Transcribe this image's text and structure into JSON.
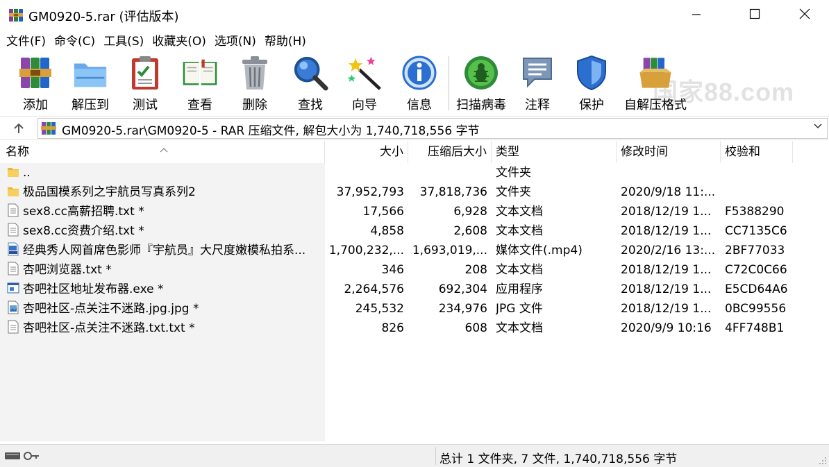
{
  "window": {
    "title": "GM0920-5.rar (评估版本)",
    "minimize_glyph": "—",
    "maximize_glyph": "☐",
    "close_glyph": "✕"
  },
  "menu": [
    "文件(F)",
    "命令(C)",
    "工具(S)",
    "收藏夹(O)",
    "选项(N)",
    "帮助(H)"
  ],
  "toolbar": [
    {
      "label": "添加",
      "icon": "add-archive-icon"
    },
    {
      "label": "解压到",
      "icon": "extract-folder-icon"
    },
    {
      "label": "测试",
      "icon": "test-clipboard-icon"
    },
    {
      "label": "查看",
      "icon": "view-book-icon"
    },
    {
      "label": "删除",
      "icon": "trash-icon"
    },
    {
      "label": "查找",
      "icon": "magnifier-icon"
    },
    {
      "label": "向导",
      "icon": "wizard-wand-icon"
    },
    {
      "label": "信息",
      "icon": "info-icon"
    },
    {
      "label": "扫描病毒",
      "icon": "virus-scan-icon"
    },
    {
      "label": "注释",
      "icon": "comment-icon"
    },
    {
      "label": "保护",
      "icon": "shield-icon"
    },
    {
      "label": "自解压格式",
      "icon": "sfx-archive-icon"
    }
  ],
  "watermark": "国家88.com",
  "address": {
    "path": "GM0920-5.rar\\GM0920-5 - RAR 压缩文件, 解包大小为 1,740,718,556 字节"
  },
  "columns": {
    "name": "名称",
    "size": "大小",
    "packed": "压缩后大小",
    "type": "类型",
    "modified": "修改时间",
    "crc": "校验和"
  },
  "files": [
    {
      "name": "..",
      "size": "",
      "packed": "",
      "type": "文件夹",
      "modified": "",
      "crc": "",
      "icon": "folder-icon"
    },
    {
      "name": "极品国模系列之宇航员写真系列2",
      "size": "37,952,793",
      "packed": "37,818,736",
      "type": "文件夹",
      "modified": "2020/9/18 11:...",
      "crc": "",
      "icon": "folder-icon"
    },
    {
      "name": "sex8.cc高薪招聘.txt *",
      "size": "17,566",
      "packed": "6,928",
      "type": "文本文档",
      "modified": "2018/12/19 1...",
      "crc": "F5388290",
      "icon": "text-file-icon"
    },
    {
      "name": "sex8.cc资费介绍.txt *",
      "size": "4,858",
      "packed": "2,608",
      "type": "文本文档",
      "modified": "2018/12/19 1...",
      "crc": "CC7135C6",
      "icon": "text-file-icon"
    },
    {
      "name": "经典秀人网首席色影师『宇航员』大尺度嫩模私拍系...",
      "size": "1,700,232,...",
      "packed": "1,693,019,...",
      "type": "媒体文件(.mp4)",
      "modified": "2020/2/16 13:...",
      "crc": "2BF77033",
      "icon": "video-file-icon"
    },
    {
      "name": "杏吧浏览器.txt *",
      "size": "346",
      "packed": "208",
      "type": "文本文档",
      "modified": "2018/12/19 1...",
      "crc": "C72C0C66",
      "icon": "text-file-icon"
    },
    {
      "name": "杏吧社区地址发布器.exe *",
      "size": "2,264,576",
      "packed": "692,304",
      "type": "应用程序",
      "modified": "2018/12/19 1...",
      "crc": "E5CD64A6",
      "icon": "exe-file-icon"
    },
    {
      "name": "杏吧社区-点关注不迷路.jpg.jpg *",
      "size": "245,532",
      "packed": "234,976",
      "type": "JPG 文件",
      "modified": "2018/12/19 1...",
      "crc": "0BC99556",
      "icon": "image-file-icon"
    },
    {
      "name": "杏吧社区-点关注不迷路.txt.txt *",
      "size": "826",
      "packed": "608",
      "type": "文本文档",
      "modified": "2020/9/9 10:16",
      "crc": "4FF748B1",
      "icon": "text-file-icon"
    }
  ],
  "status": {
    "summary": "总计 1 文件夹, 7 文件, 1,740,718,556 字节"
  }
}
